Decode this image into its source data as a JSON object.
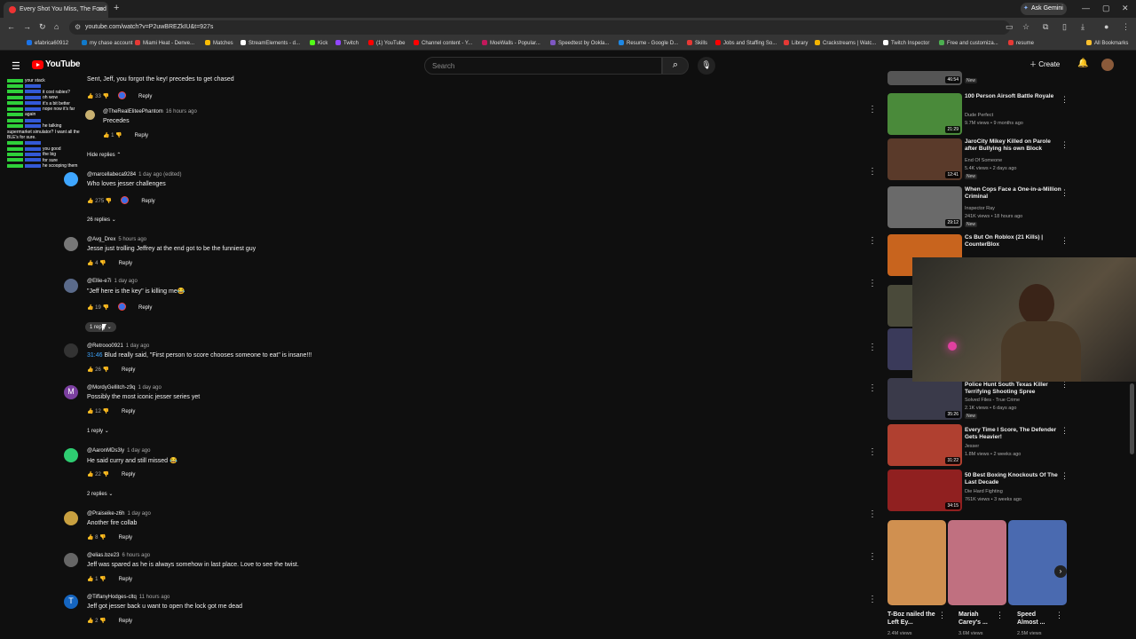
{
  "browser": {
    "tab_title": "Every Shot You Miss, The Food",
    "new_tab": "+",
    "ask_gemini": "Ask Gemini",
    "url": "youtube.com/watch?v=P2uwBREZkIU&t=927s",
    "bookmarks": [
      "efabrica60912",
      "my chase account",
      "Miami Heat - Denve...",
      "Matches",
      "StreamElements - d...",
      "Kick",
      "Twitch",
      "(1) YouTube",
      "Channel content - Y...",
      "MoeWalls - Popular...",
      "Speedtest by Ookla...",
      "Resume - Google D...",
      "Skills",
      "Jobs and Staffing So...",
      "Library",
      "Crackstreams | Watc...",
      "Twitch Inspector",
      "Free and customiza...",
      "resume",
      "All Bookmarks"
    ],
    "bookmark_colors": [
      "#1a73e8",
      "#117aca",
      "#e53935",
      "#fbbc05",
      "#ffffff",
      "#53fc18",
      "#9146ff",
      "#ff0000",
      "#ff0000",
      "#c2185b",
      "#7e57c2",
      "#1e88e5",
      "#e53935",
      "#ff0000",
      "#e53935",
      "#f4b400",
      "#ffffff",
      "#4caf50",
      "#e53935",
      "#fbc02d"
    ]
  },
  "youtube": {
    "logo_text": "YouTube",
    "search_placeholder": "Search",
    "create_label": "Create"
  },
  "chat_overlay": [
    "your stack",
    "it cost rabies?",
    "oh wow",
    "it's a bit better",
    "nope now it's far",
    "again",
    "he talking",
    "supermarket simulator? I want all the",
    "BLE's for sure.",
    "you good",
    "the big",
    "for sure",
    "he scooping them"
  ],
  "comments": [
    {
      "text": "Sent, Jeff, you forgot the key!  precedes to get chased",
      "likes": "33",
      "reply_label": "Reply"
    },
    {
      "user": "@TheRealEliteePhantom",
      "ago": "16 hours ago",
      "text": "Precedes",
      "likes": "1",
      "reply_label": "Reply"
    },
    {
      "hide_label": "Hide replies"
    },
    {
      "user": "@marcellabeca9284",
      "ago": "1 day ago (edited)",
      "text": "Who loves jesser challenges",
      "likes": "275",
      "reply_label": "Reply",
      "replies": "26 replies"
    },
    {
      "user": "@Avg_Drex",
      "ago": "5 hours ago",
      "text": "Jesse just trolling Jeffrey at the end got to be the funniest guy",
      "likes": "4",
      "reply_label": "Reply"
    },
    {
      "user": "@Ellie-e7i",
      "ago": "1 day ago",
      "text": "\"Jeff here is the key\" is killing me😂",
      "likes": "19",
      "reply_label": "Reply",
      "replies": "1 reply"
    },
    {
      "user": "@Retrooo0921",
      "ago": "1 day ago",
      "ts": "31:46",
      "text": " Blud really said, \"First person to score chooses someone to eat\" is insane!!!",
      "likes": "26",
      "reply_label": "Reply"
    },
    {
      "user": "@MordyGellitch-z9q",
      "ago": "1 day ago",
      "avatar": "M",
      "text": "Possibly the most iconic jesser series yet",
      "likes": "12",
      "reply_label": "Reply",
      "replies": "1 reply"
    },
    {
      "user": "@AaronMDs3ly",
      "ago": "1 day ago",
      "text": "He said curry and still missed 😂",
      "likes": "22",
      "reply_label": "Reply",
      "replies": "2 replies"
    },
    {
      "user": "@Praiseike-z6h",
      "ago": "1 day ago",
      "text": "Another fire collab",
      "likes": "8",
      "reply_label": "Reply"
    },
    {
      "user": "@elias.bze23",
      "ago": "6 hours ago",
      "text": "Jeff was spared as he is always somehow in last place. Love to see the twist.",
      "likes": "1",
      "reply_label": "Reply"
    },
    {
      "user": "@TiffanyHodges-cltq",
      "ago": "11 hours ago",
      "avatar": "T",
      "text": "Jeff got jesser back u want to open the lock got me dead",
      "likes": "2",
      "reply_label": "Reply"
    }
  ],
  "sidebar": {
    "top_duration": "46:54",
    "top_new": "New",
    "videos": [
      {
        "title": "100 Person Airsoft Battle Royale",
        "channel": "Dude Perfect",
        "meta": "9.7M views • 9 months ago",
        "duration": "21:29",
        "color": "#4a8a3a"
      },
      {
        "title": "JaroCity Mikey Killed on Parole after Bullying his own Block",
        "channel": "End Of Someone",
        "meta": "5.4K views • 2 days ago",
        "new": "New",
        "duration": "12:41",
        "color": "#5a3a2a"
      },
      {
        "title": "When Cops Face a One-in-a-Million Criminal",
        "channel": "Inspector Ray",
        "meta": "241K views • 18 hours ago",
        "new": "New",
        "duration": "29:12",
        "color": "#6a6a6a"
      },
      {
        "title": "Cs But On Roblox (21 Kills) | CounterBlox",
        "channel": "",
        "meta": "",
        "duration": "",
        "color": "#c8641e"
      },
      {
        "title": "Police Hunt South Texas Killer Terrifying Shooting Spree",
        "channel": "Solved Files - True Crime",
        "meta": "2.1K views • 6 days ago",
        "new": "New",
        "duration": "35:26",
        "color": "#3a3a4a"
      },
      {
        "title": "Every Time I Score, The Defender Gets Heavier!",
        "channel": "Jesser",
        "meta": "1.8M views • 2 weeks ago",
        "duration": "31:22",
        "color": "#b04030"
      },
      {
        "title": "50 Best Boxing Knockouts Of The Last Decade",
        "channel": "Die Hard Fighting",
        "meta": "761K views • 3 weeks ago",
        "duration": "34:15",
        "color": "#902020"
      }
    ],
    "shorts": [
      {
        "title": "T-Boz nailed the Left Ey...",
        "views": "2.4M views",
        "color": "#d09050"
      },
      {
        "title": "Mariah Carey's ...",
        "views": "3.6M views",
        "color": "#c07080"
      },
      {
        "title": "Speed Almost ...",
        "views": "2.5M views",
        "color": "#4a6ab0"
      }
    ]
  }
}
